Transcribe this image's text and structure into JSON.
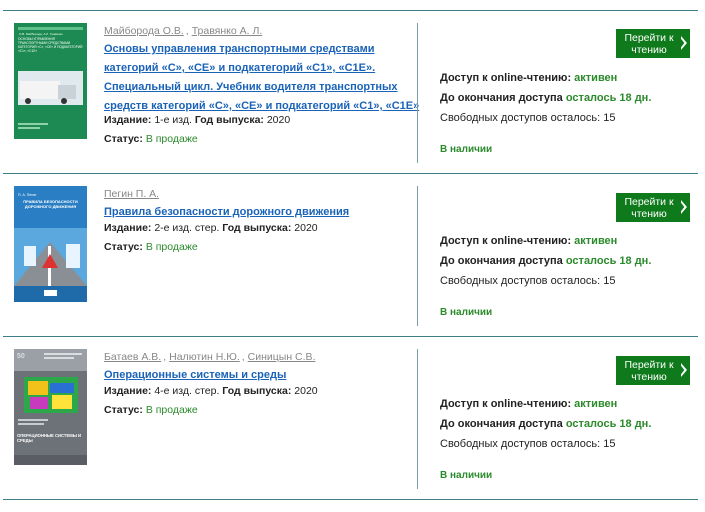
{
  "books": [
    {
      "authors": [
        "Майборода О.В.",
        "Травянко А. Л."
      ],
      "title_lines": [
        "Основы управления транспортными средствами",
        "категорий «C», «CE» и подкатегорий «C1», «C1E».",
        "Специальный цикл. Учебник водителя транспортных",
        "средств категорий «C», «CE» и подкатегорий «C1», «C1E»"
      ],
      "edition_label": "Издание:",
      "edition_value": "1-е изд.",
      "year_label": "Год выпуска:",
      "year_value": "2020",
      "status_label": "Статус:",
      "status_value": "В продаже",
      "button_label": "Перейти к чтению",
      "access_label": "Доступ к online-чтению:",
      "access_value": "активен",
      "remaining_label": "До окончания доступа",
      "remaining_value": "осталось 18 дн.",
      "free_label": "Свободных доступов осталось:",
      "free_value": "15",
      "availability": "В наличии",
      "cover_text": [
        "О.В. Майборода, А.Л. Травянко",
        "ОСНОВЫ УПРАВЛЕНИЯ ТРАНСПОРТНЫМИ СРЕДСТВАМИ КАТЕГОРИЙ «С», «СЕ» И ПОДКАТЕГОРИЙ «С1», «С1Е»"
      ]
    },
    {
      "authors": [
        "Пегин П. А."
      ],
      "title_lines": [
        "Правила безопасности дорожного движения"
      ],
      "edition_label": "Издание:",
      "edition_value": "2-е изд. стер.",
      "year_label": "Год выпуска:",
      "year_value": "2020",
      "status_label": "Статус:",
      "status_value": "В продаже",
      "button_label": "Перейти к чтению",
      "access_label": "Доступ к online-чтению:",
      "access_value": "активен",
      "remaining_label": "До окончания доступа",
      "remaining_value": "осталось 18 дн.",
      "free_label": "Свободных доступов осталось:",
      "free_value": "15",
      "availability": "В наличии",
      "cover_text": [
        "П. А. Пегин",
        "ПРАВИЛА БЕЗОПАСНОСТИ ДОРОЖНОГО ДВИЖЕНИЯ"
      ]
    },
    {
      "authors": [
        "Батаев А.В.",
        "Налютин Н.Ю.",
        "Синицын С.В."
      ],
      "title_lines": [
        "Операционные системы и среды"
      ],
      "edition_label": "Издание:",
      "edition_value": "4-е изд. стер.",
      "year_label": "Год выпуска:",
      "year_value": "2020",
      "status_label": "Статус:",
      "status_value": "В продаже",
      "button_label": "Перейти к чтению",
      "access_label": "Доступ к online-чтению:",
      "access_value": "активен",
      "remaining_label": "До окончания доступа",
      "remaining_value": "осталось 18 дн.",
      "free_label": "Свободных доступов осталось:",
      "free_value": "15",
      "availability": "В наличии",
      "cover_text": [
        "ОПЕРАЦИОННЫЕ СИСТЕМЫ И СРЕДЫ"
      ]
    }
  ]
}
